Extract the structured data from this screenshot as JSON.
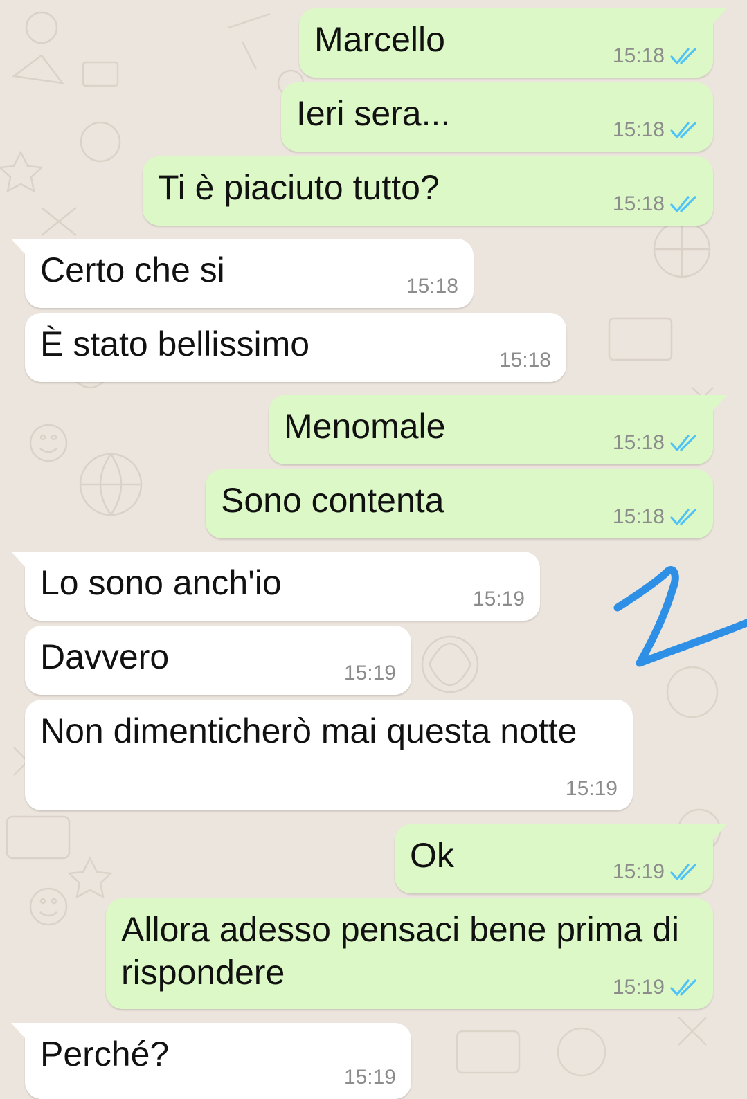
{
  "chat": {
    "messages": [
      {
        "dir": "out",
        "text": "Marcello",
        "time": "15:18",
        "status": "read-ticks-icon",
        "tail": true
      },
      {
        "dir": "out",
        "text": "Ieri sera...",
        "time": "15:18",
        "status": "read-ticks-icon",
        "tail": false
      },
      {
        "dir": "out",
        "text": "Ti è piaciuto tutto?",
        "time": "15:18",
        "status": "read-ticks-icon",
        "tail": false
      },
      {
        "dir": "in",
        "text": "Certo che si",
        "time": "15:18",
        "tail": true
      },
      {
        "dir": "in",
        "text": "È stato bellissimo",
        "time": "15:18",
        "tail": false
      },
      {
        "dir": "out",
        "text": "Menomale",
        "time": "15:18",
        "status": "read-ticks-icon",
        "tail": true
      },
      {
        "dir": "out",
        "text": "Sono contenta",
        "time": "15:18",
        "status": "read-ticks-icon",
        "tail": false
      },
      {
        "dir": "in",
        "text": "Lo sono anch'io",
        "time": "15:19",
        "tail": true
      },
      {
        "dir": "in",
        "text": "Davvero",
        "time": "15:19",
        "tail": false
      },
      {
        "dir": "in",
        "text": "Non dimenticherò mai questa notte",
        "time": "15:19",
        "tail": false
      },
      {
        "dir": "out",
        "text": "Ok",
        "time": "15:19",
        "status": "read-ticks-icon",
        "tail": true
      },
      {
        "dir": "out",
        "text": "Allora adesso pensaci bene prima di\nrispondere",
        "time": "15:19",
        "status": "read-ticks-icon",
        "tail": false
      },
      {
        "dir": "in",
        "text": "Perché?",
        "time": "15:19",
        "tail": true
      }
    ]
  },
  "colors": {
    "background": "#ece5dd",
    "outgoing_bubble": "#dcf8c6",
    "incoming_bubble": "#ffffff",
    "read_ticks": "#4fc3f7",
    "annotation_stroke": "#2e8fe6"
  },
  "annotation": {
    "icon": "hand-drawn-number-icon"
  }
}
